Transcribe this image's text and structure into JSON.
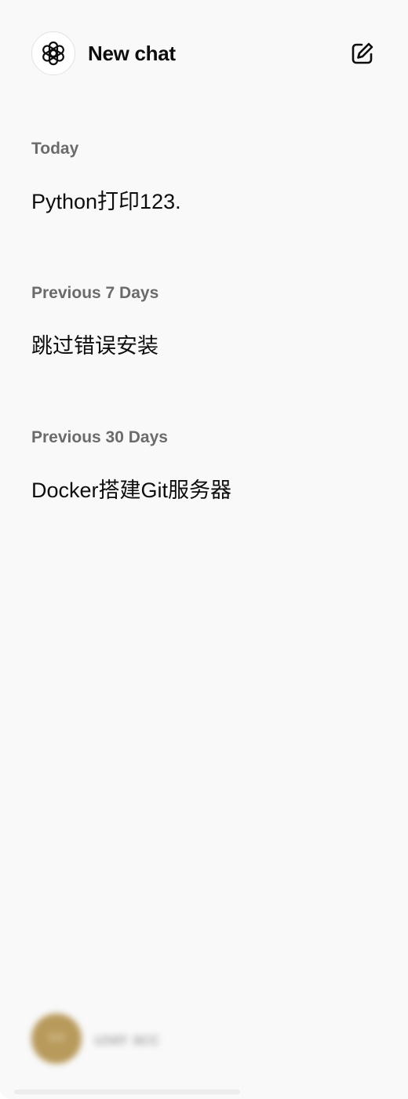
{
  "header": {
    "title": "New chat",
    "logo_icon": "openai-logo-icon",
    "compose_icon": "edit-square-icon"
  },
  "sections": [
    {
      "label": "Today",
      "items": [
        "Python打印123."
      ]
    },
    {
      "label": "Previous 7 Days",
      "items": [
        "跳过错误安装"
      ]
    },
    {
      "label": "Previous 30 Days",
      "items": [
        "Docker搭建Git服务器"
      ]
    }
  ],
  "user": {
    "avatar_text": "XX",
    "name": "user acc"
  },
  "colors": {
    "sidebar_bg": "#f9f9f9",
    "section_label": "#6b6b6b",
    "text": "#0d0d0d",
    "avatar": "#b89a5c"
  }
}
